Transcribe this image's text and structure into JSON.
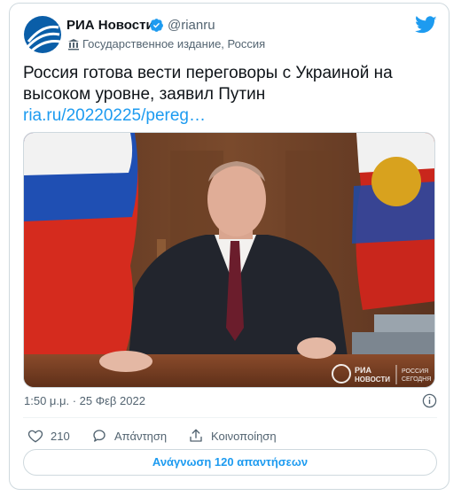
{
  "author": {
    "name": "РИА Новости",
    "handle": "@rianru",
    "label": "Государственное издание, Россия",
    "verified": true
  },
  "tweet": {
    "text": "Россия готова вести переговоры с Украиной на высоком уровне, заявил Путин",
    "link": "ria.ru/20220225/pereg…",
    "timestamp": "1:50 μ.μ. · 25 Φεβ 2022"
  },
  "media": {
    "watermark_left_1": "РИА",
    "watermark_left_2": "НОВОСТИ",
    "watermark_right_1": "РОССИЯ",
    "watermark_right_2": "СЕГОДНЯ"
  },
  "actions": {
    "like_count": "210",
    "reply_label": "Απάντηση",
    "share_label": "Κοινοποίηση"
  },
  "read_replies_label": "Ανάγνωση 120 απαντήσεων",
  "colors": {
    "accent": "#1d9bf0",
    "text_primary": "#0f1419",
    "text_secondary": "#536471",
    "border": "#cfd9de"
  },
  "icons": [
    "ria-logo-icon",
    "verified-badge-icon",
    "government-building-icon",
    "twitter-bird-icon",
    "info-icon",
    "heart-icon",
    "reply-bubble-icon",
    "share-icon"
  ]
}
